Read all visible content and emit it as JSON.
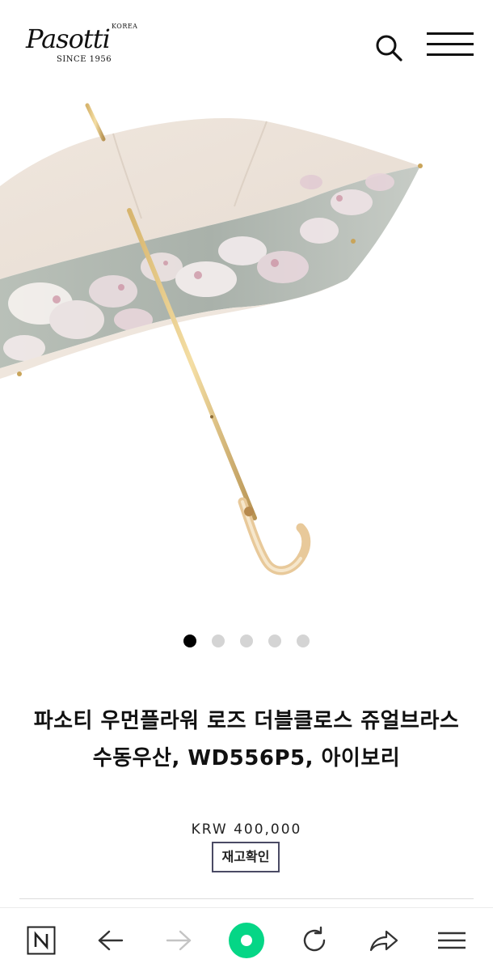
{
  "header": {
    "logo_script": "Pasotti",
    "logo_country": "KOREA",
    "logo_since": "SINCE 1956",
    "search_icon": "search-icon",
    "menu_icon": "hamburger-menu-icon"
  },
  "gallery": {
    "image": "umbrella-product-photo",
    "slide_count": 5,
    "active_slide": 1
  },
  "product": {
    "title": "파소티 우먼플라워 로즈 더블클로스 쥬얼브라스 수동우산, WD556P5, 아이보리",
    "price": "KRW 400,000",
    "stock_button": "재고확인"
  },
  "bottom_nav": {
    "items": [
      "naver-home-icon",
      "back-arrow-icon",
      "forward-arrow-icon",
      "green-circle-icon",
      "refresh-icon",
      "share-icon",
      "menu-icon"
    ],
    "accent_color": "#05d686"
  }
}
